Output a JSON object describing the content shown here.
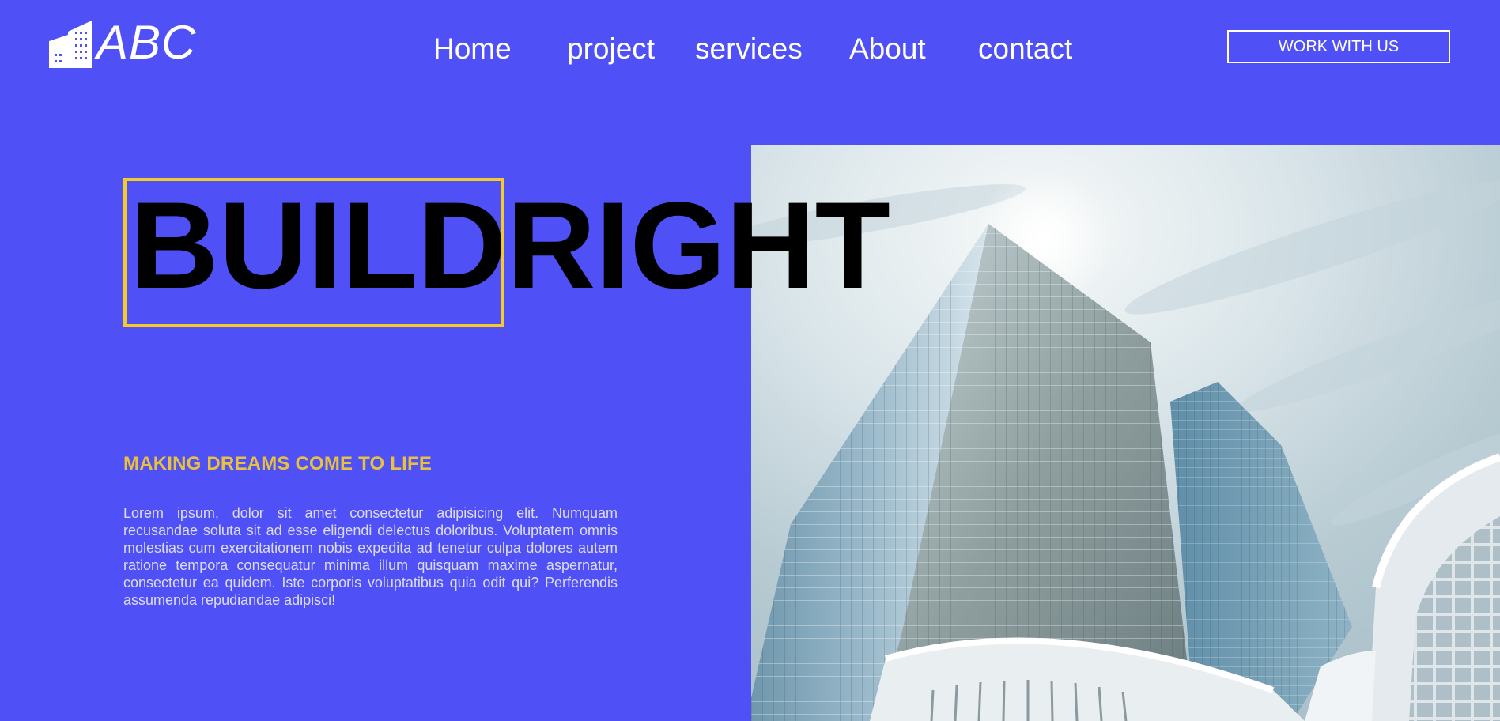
{
  "header": {
    "logo_text": "ABC",
    "logo_icon": "city-buildings-icon",
    "nav": [
      {
        "label": "Home"
      },
      {
        "label": "project"
      },
      {
        "label": "services"
      },
      {
        "label": "About"
      },
      {
        "label": "contact"
      }
    ],
    "cta_label": "WORK WITH US"
  },
  "hero": {
    "headline_part1": "BUILD",
    "headline_part2": "RIGHT",
    "tagline": "MAKING DREAMS COME TO LIFE",
    "body": "Lorem ipsum, dolor sit amet consectetur adipisicing elit. Numquam recusandae soluta sit ad esse eligendi delectus doloribus. Voluptatem omnis molestias cum exercitationem nobis expedita ad tenetur culpa dolores autem ratione tempora consequatur minima illum quisquam maxime aspernatur, consectetur ea quidem. Iste corporis voluptatibus quia odit qui? Perferendis assumenda repudiandae adipisci!",
    "image": "office-building-photo"
  },
  "colors": {
    "background": "#4f50f5",
    "accent_yellow": "#f5cc25",
    "tagline": "#e7c13f",
    "text_white": "#ffffff",
    "headline": "#000000"
  }
}
